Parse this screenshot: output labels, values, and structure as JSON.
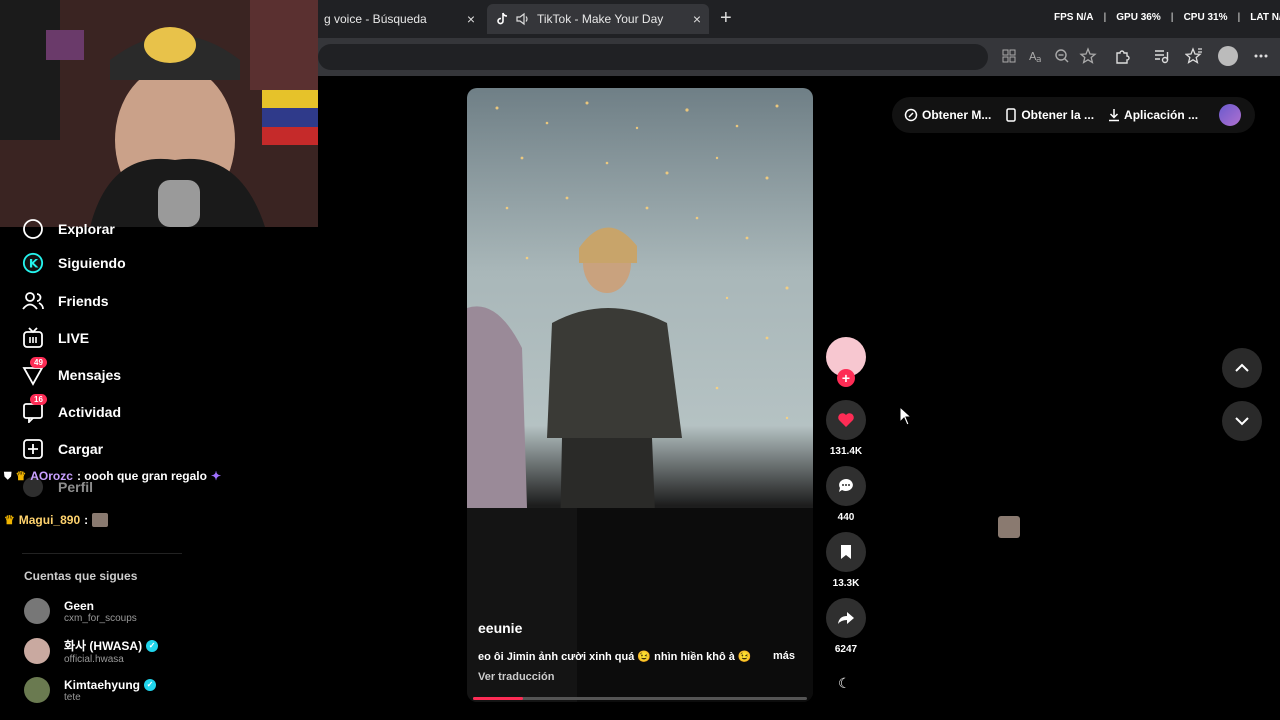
{
  "browser": {
    "tabs": [
      {
        "title": "g voice - Búsqueda",
        "close": "×"
      },
      {
        "title": "TikTok - Make Your Day",
        "close": "×"
      }
    ],
    "new_tab": "+"
  },
  "overlay": {
    "fps_label": "FPS",
    "fps_value": "N/A",
    "gpu_label": "GPU",
    "gpu_value": "36%",
    "cpu_label": "CPU",
    "cpu_value": "31%",
    "lat_label": "LAT",
    "lat_value": "N/A"
  },
  "sidebar": {
    "items": [
      {
        "label": "Explorar",
        "icon": "compass-icon"
      },
      {
        "label": "Siguiendo",
        "icon": "following-icon"
      },
      {
        "label": "Friends",
        "icon": "friends-icon"
      },
      {
        "label": "LIVE",
        "icon": "live-icon"
      },
      {
        "label": "Mensajes",
        "icon": "messages-icon",
        "badge": "49"
      },
      {
        "label": "Actividad",
        "icon": "activity-icon",
        "badge": "16"
      },
      {
        "label": "Cargar",
        "icon": "upload-icon"
      },
      {
        "label": "Perfil",
        "icon": "profile-icon"
      }
    ],
    "following_title": "Cuentas que sigues",
    "accounts": [
      {
        "name": "Geen",
        "handle": "cxm_for_scoups",
        "verified": false
      },
      {
        "name": "화사 (HWASA)",
        "handle": "official.hwasa",
        "verified": true
      },
      {
        "name": "Kimtaehyung",
        "handle": "tete",
        "verified": true
      }
    ]
  },
  "chat": [
    {
      "user": "AOrozc",
      "message": ": oooh que gran regalo"
    },
    {
      "user": "Magui_890",
      "message": ":"
    }
  ],
  "video": {
    "username": "eeunie",
    "description": "eo ôi Jimin ảnh cười xinh quá 😉 nhìn hiền khô à 😉",
    "more": "más",
    "translate": "Ver traducción",
    "progress_fraction": 0.15
  },
  "actions": {
    "likes": "131.4K",
    "comments": "440",
    "saves": "13.3K",
    "shares": "6247"
  },
  "top_pill": {
    "item1": "Obtener M...",
    "item2": "Obtener la ...",
    "item3": "Aplicación ..."
  },
  "colors": {
    "accent": "#fe2c55",
    "verified": "#20d5ec",
    "following_green": "#25f4ee"
  }
}
